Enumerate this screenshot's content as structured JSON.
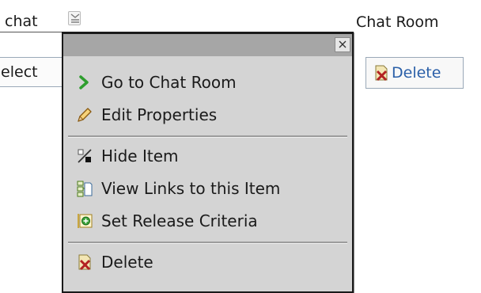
{
  "page": {
    "item_link": "chat",
    "item_type": "Chat Room",
    "select_field": "Select",
    "delete_button": "Delete"
  },
  "menu": {
    "close_symbol": "×",
    "items": [
      {
        "label": "Go to Chat Room",
        "icon": "arrow-right-icon"
      },
      {
        "label": "Edit Properties",
        "icon": "pencil-icon"
      },
      {
        "label": "Hide Item",
        "icon": "hide-icon"
      },
      {
        "label": "View Links to this Item",
        "icon": "links-icon"
      },
      {
        "label": "Set Release Criteria",
        "icon": "release-criteria-icon"
      },
      {
        "label": "Delete",
        "icon": "delete-icon"
      }
    ]
  },
  "colors": {
    "menu_background": "#d4d4d4",
    "menu_titlebar": "#a6a6a6",
    "arrow_green": "#2e9e2e",
    "delete_red": "#b32222",
    "link_blue": "#2a5fa8"
  }
}
